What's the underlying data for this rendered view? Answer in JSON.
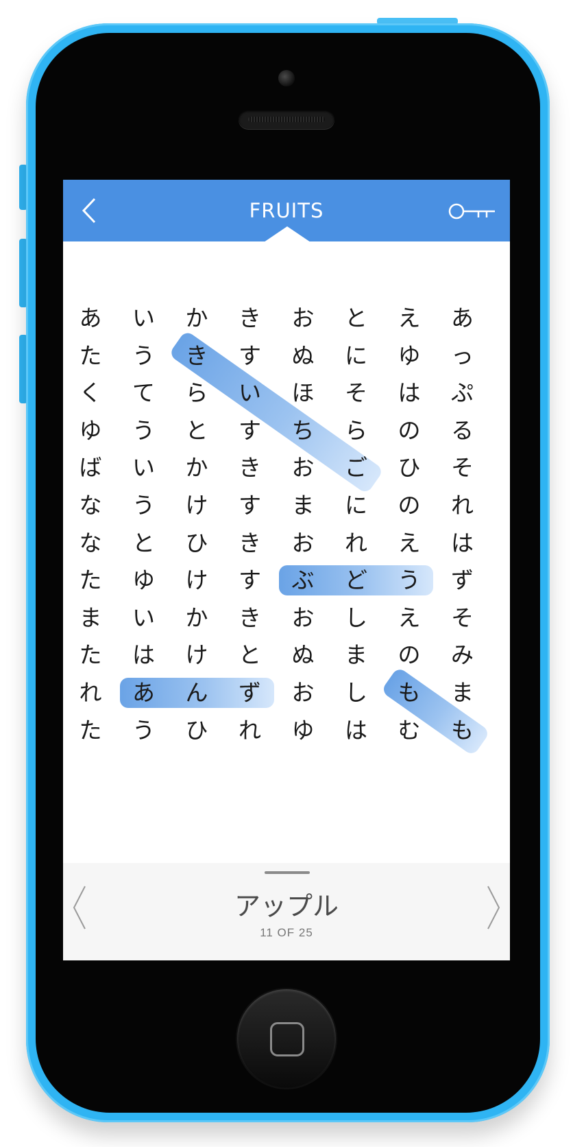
{
  "header": {
    "title": "FRUITS",
    "back_icon": "chevron-left-icon",
    "hint_icon": "key-icon",
    "color": "#4a90e2"
  },
  "grid": {
    "rows": [
      [
        "あ",
        "い",
        "か",
        "き",
        "お",
        "と",
        "え",
        "あ"
      ],
      [
        "た",
        "う",
        "き",
        "す",
        "ぬ",
        "に",
        "ゆ",
        "っ"
      ],
      [
        "く",
        "て",
        "ら",
        "い",
        "ほ",
        "そ",
        "は",
        "ぷ"
      ],
      [
        "ゆ",
        "う",
        "と",
        "す",
        "ち",
        "ら",
        "の",
        "る"
      ],
      [
        "ば",
        "い",
        "か",
        "き",
        "お",
        "ご",
        "ひ",
        "そ"
      ],
      [
        "な",
        "う",
        "け",
        "す",
        "ま",
        "に",
        "の",
        "れ"
      ],
      [
        "な",
        "と",
        "ひ",
        "き",
        "お",
        "れ",
        "え",
        "は"
      ],
      [
        "た",
        "ゆ",
        "け",
        "す",
        "ぶ",
        "ど",
        "う",
        "ず"
      ],
      [
        "ま",
        "い",
        "か",
        "き",
        "お",
        "し",
        "え",
        "そ"
      ],
      [
        "た",
        "は",
        "け",
        "と",
        "ぬ",
        "ま",
        "の",
        "み"
      ],
      [
        "れ",
        "あ",
        "ん",
        "ず",
        "お",
        "し",
        "も",
        "ま"
      ],
      [
        "た",
        "う",
        "ひ",
        "れ",
        "ゆ",
        "は",
        "む",
        "も"
      ]
    ],
    "found_words": [
      {
        "word": "きいちご",
        "start": [
          1,
          2
        ],
        "end": [
          4,
          5
        ]
      },
      {
        "word": "ぶどう",
        "start": [
          7,
          4
        ],
        "end": [
          7,
          6
        ]
      },
      {
        "word": "あんず",
        "start": [
          10,
          1
        ],
        "end": [
          10,
          3
        ]
      },
      {
        "word": "もも",
        "start": [
          10,
          6
        ],
        "end": [
          11,
          7
        ]
      }
    ],
    "highlight_color": "#6aa3e6"
  },
  "footer": {
    "word": "アップル",
    "progress": "11 OF 25",
    "prev_icon": "chevron-left-icon",
    "next_icon": "chevron-right-icon"
  }
}
